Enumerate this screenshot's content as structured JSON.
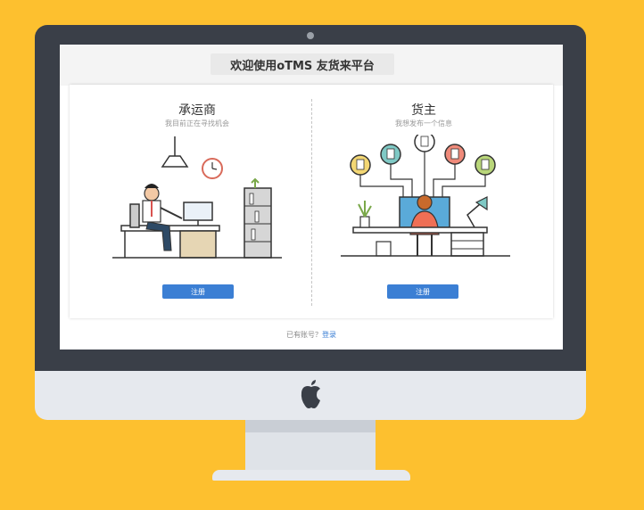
{
  "header": {
    "title": "欢迎使用oTMS 友货来平台"
  },
  "panes": [
    {
      "title": "承运商",
      "subtitle": "我目前正在寻找机会",
      "register_label": "注册"
    },
    {
      "title": "货主",
      "subtitle": "我想发布一个信息",
      "register_label": "注册"
    }
  ],
  "footer": {
    "prompt": "已有账号？",
    "login_label": "登录"
  },
  "colors": {
    "background": "#FDC02F",
    "monitor": "#3a3f48",
    "accent": "#3b7fd4"
  }
}
